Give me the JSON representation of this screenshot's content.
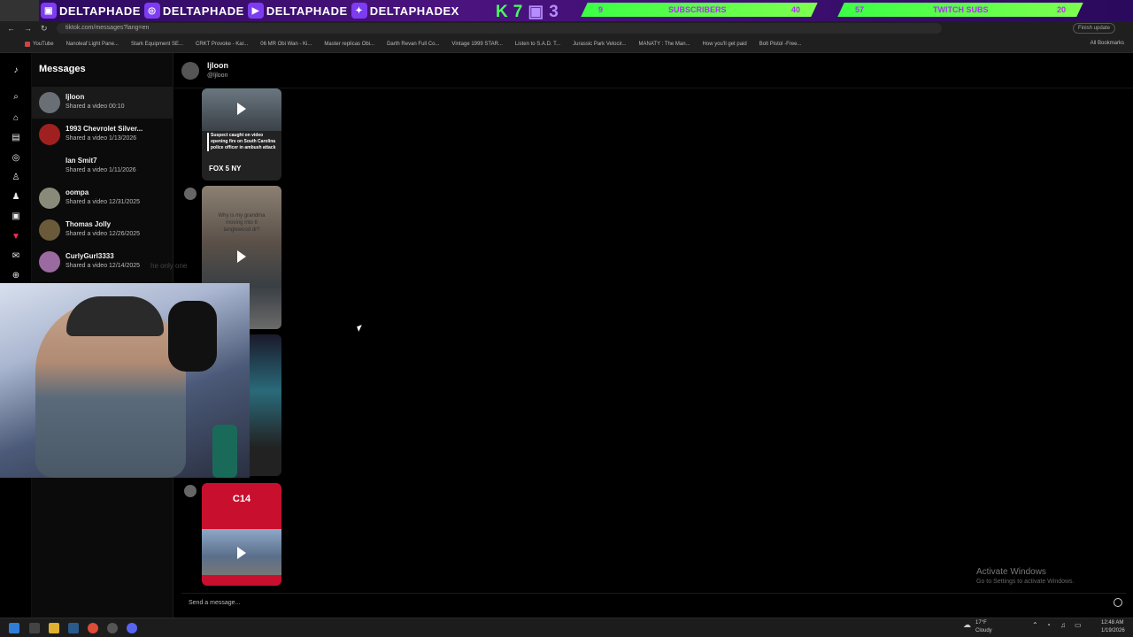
{
  "overlay": {
    "socials": [
      {
        "icon": "twitch-icon",
        "label": "DELTAPHADE"
      },
      {
        "icon": "instagram-icon",
        "label": "DELTAPHADE"
      },
      {
        "icon": "youtube-icon",
        "label": "DELTAPHADE"
      },
      {
        "icon": "twitter-icon",
        "label": "DELTAPHADEX"
      }
    ],
    "kt": {
      "k": "K",
      "seven": "7",
      "three": "3"
    },
    "subscribers": {
      "current": "9",
      "label": "SUBSCRIBERS",
      "goal": "40"
    },
    "twitch_subs": {
      "current": "57",
      "label": "TWITCH SUBS",
      "goal": "20"
    }
  },
  "browser": {
    "url": "tiktok.com/messages?lang=en",
    "update_label": "Finish update",
    "bookmarks": [
      "YouTube",
      "Nanoleaf Light Pane...",
      "Stark Equipment SE...",
      "CRKT Provoke - Kar...",
      "06 MR Obi Wan - Ki...",
      "Master replicas Obi...",
      "Darth Revan Full Co...",
      "Vintage 1999 STAR...",
      "Listen to S.A.D. T...",
      "Jurassic Park Velocir...",
      "MANATY : The Man...",
      "How you'll get paid",
      "Bolt Pistol -Free..."
    ],
    "all_bookmarks": "All Bookmarks"
  },
  "messages": {
    "title": "Messages",
    "conversations": [
      {
        "name": "ljloon",
        "preview": "Shared a video 00:10"
      },
      {
        "name": "1993 Chevrolet Silver...",
        "preview": "Shared a video 1/13/2026"
      },
      {
        "name": "Ian Smit7",
        "preview": "Shared a video 1/11/2026"
      },
      {
        "name": "oompa",
        "preview": "Shared a video 12/31/2025"
      },
      {
        "name": "Thomas Jolly",
        "preview": "Shared a video 12/26/2025"
      },
      {
        "name": "CurlyGurl3333",
        "preview": "Shared a video 12/14/2025"
      }
    ]
  },
  "chat": {
    "name": "ljloon",
    "handle": "@ljloon",
    "video1": {
      "caption": "Suspect caught on video opening fire on South Carolina police officer in ambush attack",
      "source": "FOX 5 NY"
    },
    "video2": {
      "caption": "Why is my grandma moving into 6 tanglewood dr?"
    },
    "video4": {
      "logo": "C14"
    },
    "compose_placeholder": "Send a message...",
    "ghost_text": "he only one"
  },
  "windows": {
    "activate_title": "Activate Windows",
    "activate_sub": "Go to Settings to activate Windows.",
    "weather_temp": "17°F",
    "weather_desc": "Cloudy",
    "time": "12:48 AM",
    "date": "1/19/2026"
  },
  "colors": {
    "accent_green": "#46ff5b",
    "accent_purple": "#7d3cf0",
    "tiktok_red": "#fe2c55"
  }
}
